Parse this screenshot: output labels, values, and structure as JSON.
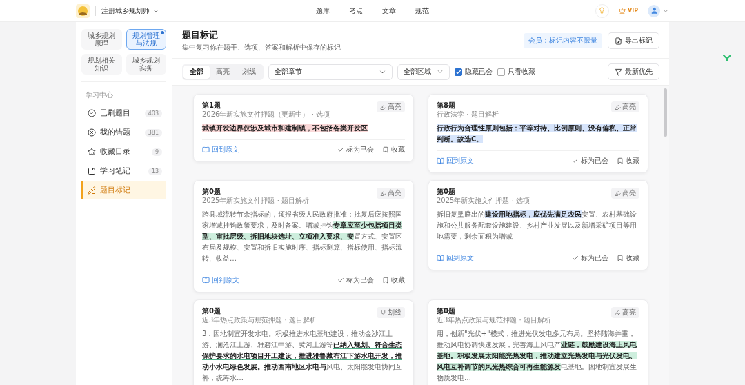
{
  "topbar": {
    "exam": "注册城乡规划师",
    "nav": [
      {
        "label": "题库"
      },
      {
        "label": "考点"
      },
      {
        "label": "文章"
      },
      {
        "label": "规范"
      }
    ],
    "vip": "VIP"
  },
  "sidebar": {
    "subjects": [
      {
        "label": "城乡规划原理",
        "selected": false
      },
      {
        "label": "规划管理与法规",
        "selected": true
      },
      {
        "label": "规划相关知识",
        "selected": false
      },
      {
        "label": "城乡规划实务",
        "selected": false
      }
    ],
    "section_title": "学习中心",
    "items": [
      {
        "kind": "done",
        "label": "已刷题目",
        "count": "403",
        "selected": false
      },
      {
        "kind": "wrong",
        "label": "我的错题",
        "count": "381",
        "selected": false
      },
      {
        "kind": "favorite",
        "label": "收藏目录",
        "count": "9",
        "selected": false
      },
      {
        "kind": "notes",
        "label": "学习笔记",
        "count": "13",
        "selected": false
      },
      {
        "kind": "marks",
        "label": "题目标记",
        "selected": true
      }
    ]
  },
  "header": {
    "title": "题目标记",
    "subtitle": "集中复习你在题干、选项、答案和解析中保存的标记",
    "member_badge": "会员：标记内容不限量",
    "export_button": "导出标记"
  },
  "filters": {
    "tabs": [
      {
        "label": "全部",
        "selected": true
      },
      {
        "label": "高亮",
        "selected": false
      },
      {
        "label": "划线",
        "selected": false
      }
    ],
    "chapter_select": "全部章节",
    "region_select": "全部区域",
    "checkboxes": [
      {
        "label": "隐藏已会",
        "checked": true
      },
      {
        "label": "只看收藏",
        "checked": false
      }
    ],
    "sort_button": "最新优先"
  },
  "cards": [
    {
      "title": "第1题",
      "meta": "2026年新实施文件押题（更新中） · 选项",
      "tag": {
        "kind": "highlight",
        "label": "高亮"
      },
      "segments": [
        {
          "kind": "highlight",
          "color": "#fbd9d9",
          "text": "城镇开发边界仅涉及城市和建制镇，不包括各类开发区"
        }
      ],
      "actions": {
        "source": "回到原文",
        "known": "标为已会",
        "favorite": "收藏"
      }
    },
    {
      "title": "第8题",
      "meta": "行政法学 · 题目解析",
      "tag": {
        "kind": "highlight",
        "label": "高亮"
      },
      "segments": [
        {
          "kind": "highlight",
          "color": "#d6e4fb",
          "text": "行政行为合理性原则包括：平等对待、比例原则、没有偏私、正常判断。故选C。"
        }
      ],
      "actions": {
        "source": "回到原文",
        "known": "标为已会",
        "favorite": "收藏"
      }
    },
    {
      "title": "第0题",
      "meta": "2025年新实施文件押题 · 题目解析",
      "tag": {
        "kind": "highlight",
        "label": "高亮"
      },
      "segments": [
        {
          "kind": "plain",
          "text": "跨县域流转节余指标的，须报省级人民政府批准：批复后应按照国家增减挂钩政策要求，及时备案。增减挂钩"
        },
        {
          "kind": "highlight",
          "color": "#cdeedd",
          "text": "专章应至少包括项目类型、审批层级、拆旧地块选址、立项准入要求、安"
        },
        {
          "kind": "plain",
          "text": "置方式、安置区布局及规模、安置和拆旧实施时序、指标测算、指标使用、指标流转、收益…"
        }
      ],
      "actions": {
        "source": "回到原文",
        "known": "标为已会",
        "favorite": "收藏"
      }
    },
    {
      "title": "第0题",
      "meta": "2025年新实施文件押题 · 选项",
      "tag": {
        "kind": "highlight",
        "label": "高亮"
      },
      "segments": [
        {
          "kind": "plain",
          "text": "拆旧复垦腾出的"
        },
        {
          "kind": "highlight",
          "color": "#d6e4fb",
          "text": "建设用地指标，应优先满足农民"
        },
        {
          "kind": "plain",
          "text": "安置、农村基础设施和公共服务配套设施建设、乡村产业发展以及新增采矿项目等用地需要，剩余面积为增减"
        }
      ],
      "actions": {
        "source": "回到原文",
        "known": "标为已会",
        "favorite": "收藏"
      }
    },
    {
      "title": "第0题",
      "meta": "近3年热点政策与规范押题 · 题目解析",
      "tag": {
        "kind": "underline",
        "label": "划线"
      },
      "segments": [
        {
          "kind": "plain",
          "text": "3．因地制宜开发水电。积极推进水电基地建设，推动金沙江上游、澜沧江上游、雅砻江中游、黄河上游等"
        },
        {
          "kind": "underline",
          "color": "#4fb38a",
          "text": "已纳入规划、符合生态保护要求的水电项目开工建设，推进雅鲁藏布江下游水电开发，推动小水电绿色发展。推动西南地区水电与"
        },
        {
          "kind": "plain",
          "text": "风电、太阳能发电协同互补，统筹水…"
        }
      ]
    },
    {
      "title": "第0题",
      "meta": "近3年热点政策与规范押题 · 题目解析",
      "tag": {
        "kind": "highlight",
        "label": "高亮"
      },
      "segments": [
        {
          "kind": "plain",
          "text": "用，创新\"光伏+\"模式，推进光伏发电多元布局。坚持陆海并重，推动风电协调快速发展，完善海上风电产"
        },
        {
          "kind": "highlight",
          "color": "#cdeedd",
          "text": "业链，鼓励建设海上风电基地。积极发展太阳能光热发电，推动建立光热发电与光伏发电、风电互补调节的风光热综合可再生能源发"
        },
        {
          "kind": "plain",
          "text": "电基地。因地制宜发展生物质发电…"
        }
      ]
    }
  ]
}
